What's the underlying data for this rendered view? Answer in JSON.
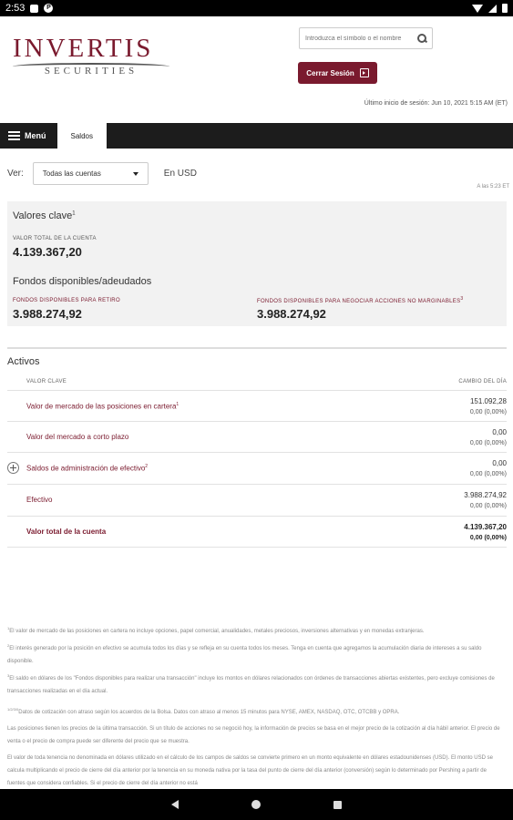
{
  "status_bar": {
    "time": "2:53"
  },
  "header": {
    "logo_main": "INVERTIS",
    "logo_sub": "SECURITIES",
    "search_placeholder": "Introduzca el símbolo o el nombre",
    "logout_label": "Cerrar Sesión",
    "last_login": "Último inicio de sesión: Jun 10, 2021 5:15 AM (ET)"
  },
  "nav": {
    "menu_label": "Menú",
    "active_tab": "Saldos"
  },
  "view": {
    "label": "Ver:",
    "selected_account": "Todas las cuentas",
    "currency": "En USD",
    "as_of": "A las 5:23 ET"
  },
  "key_values": {
    "title": "Valores clave",
    "title_sup": "1",
    "total_label": "VALOR TOTAL DE LA CUENTA",
    "total_value": "4.139.367,20",
    "funds_title": "Fondos disponibles/adeudados",
    "withdraw_label": "FONDOS DISPONIBLES PARA RETIRO",
    "withdraw_value": "3.988.274,92",
    "trade_label": "FONDOS DISPONIBLES PARA NEGOCIAR ACCIONES NO MARGINABLES",
    "trade_sup": "3",
    "trade_value": "3.988.274,92"
  },
  "assets": {
    "title": "Activos",
    "col_key": "VALOR CLAVE",
    "col_change": "CAMBIO DEL DÍA",
    "rows": [
      {
        "label": "Valor de mercado de las posiciones en cartera",
        "sup": "1",
        "v1": "151.092,28",
        "v2": "0,00   (0,00%)"
      },
      {
        "label": "Valor del mercado a corto plazo",
        "sup": "",
        "v1": "0,00",
        "v2": "0,00   (0,00%)"
      },
      {
        "label": "Saldos de administración de efectivo",
        "sup": "2",
        "v1": "0,00",
        "v2": "0,00   (0,00%)"
      },
      {
        "label": "Efectivo",
        "sup": "",
        "v1": "3.988.274,92",
        "v2": "0,00   (0,00%)"
      },
      {
        "label": "Valor total de la cuenta",
        "sup": "",
        "v1": "4.139.367,20",
        "v2": "0,00   (0,00%)"
      }
    ]
  },
  "footnotes": [
    {
      "sup": "1",
      "text": "El valor de mercado de las posiciones en cartera no incluye opciones, papel comercial, anualidades, metales preciosos, inversiones alternativas y en monedas extranjeras."
    },
    {
      "sup": "2",
      "text": "El interés generado por la posición en efectivo se acumula todos los días y se refleja en su cuenta todos los meses. Tenga en cuenta que agregamos la acumulación diaria de intereses a su saldo disponible."
    },
    {
      "sup": "3",
      "text": "El saldo en dólares de los \"Fondos disponibles para realizar una transacción\" incluye los montos en dólares relacionados con órdenes de transacciones abiertas existentes, pero excluye comisiones de transacciones realizadas en el día actual."
    },
    {
      "sup": "1/2/3/0",
      "text": "Datos de cotización con atraso según los acuerdos de la Bolsa. Datos con atraso al menos 15 minutos para NYSE, AMEX, NASDAQ, OTC, OTCBB y OPRA."
    },
    {
      "sup": "",
      "text": "Las posiciones tienen los precios de la última transacción. Si un título de acciones no se negoció hoy, la información de precios se basa en el mejor precio de la cotización al día hábil anterior. El precio de venta o el precio de compra puede ser diferente del precio que se muestra."
    },
    {
      "sup": "",
      "text": "El valor de toda tenencia no denominada en dólares utilizado en el cálculo de los campos de saldos se convierte primero en un monto equivalente en dólares estadounidenses (USD). El monto USD se calcula multiplicando el precio de cierre del día anterior por la tenencia en su moneda nativa por la tasa del punto de cierre del día anterior (conversión) según lo determinado por Pershing a partir de fuentes que considera confiables. Si el precio de cierre del día anterior no está"
    }
  ]
}
